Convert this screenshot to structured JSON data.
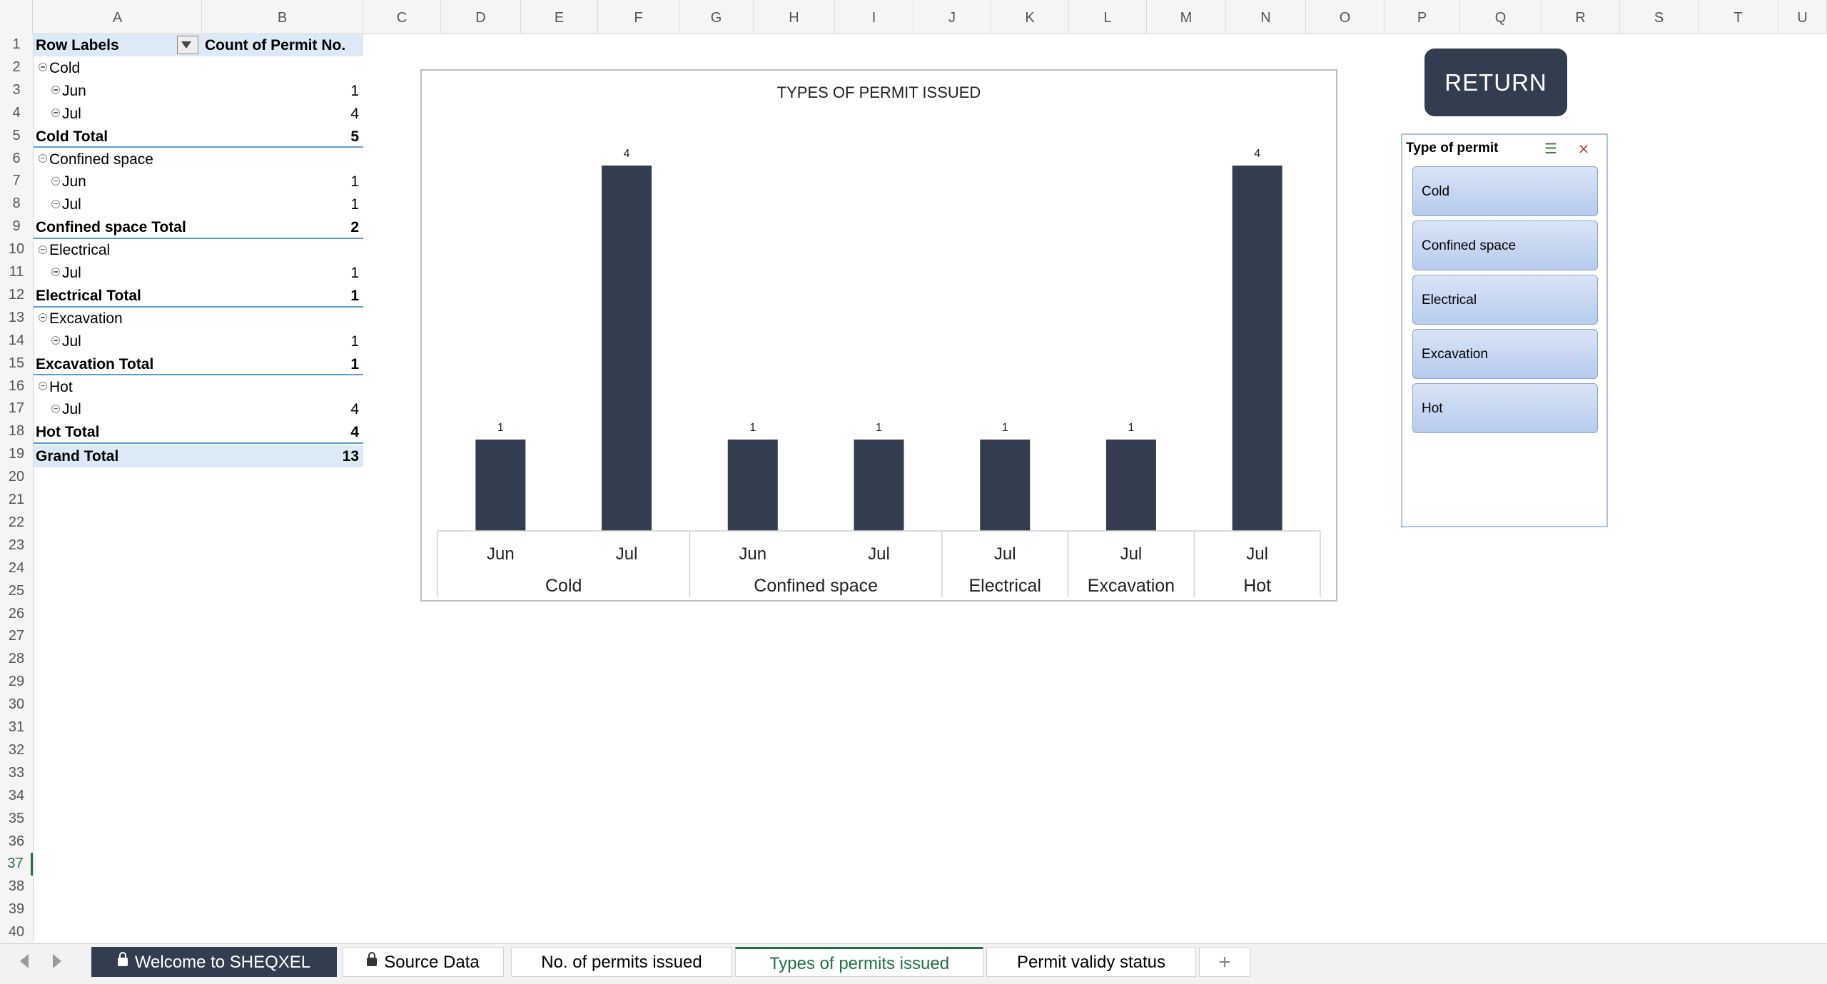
{
  "columns": [
    "A",
    "B",
    "C",
    "D",
    "E",
    "F",
    "G",
    "H",
    "I",
    "J",
    "K",
    "L",
    "M",
    "N",
    "O",
    "P",
    "Q",
    "R",
    "S",
    "T",
    "U"
  ],
  "rows": [
    "1",
    "2",
    "3",
    "4",
    "5",
    "6",
    "7",
    "8",
    "9",
    "10",
    "11",
    "12",
    "13",
    "14",
    "15",
    "16",
    "17",
    "18",
    "19",
    "20",
    "21",
    "22",
    "23",
    "24",
    "25",
    "26",
    "27",
    "28",
    "29",
    "30",
    "31",
    "32",
    "33",
    "34",
    "35",
    "36",
    "37",
    "38",
    "39",
    "40"
  ],
  "pivot": {
    "header_labels": "Row Labels",
    "header_count": "Count of Permit No.",
    "lines": [
      {
        "row": 2,
        "label": "Cold",
        "indent": 1,
        "value": "",
        "total": false
      },
      {
        "row": 3,
        "label": "Jun",
        "indent": 2,
        "value": "1",
        "total": false
      },
      {
        "row": 4,
        "label": "Jul",
        "indent": 2,
        "value": "4",
        "total": false
      },
      {
        "row": 5,
        "label": "Cold Total",
        "indent": 0,
        "value": "5",
        "total": true
      },
      {
        "row": 6,
        "label": "Confined space",
        "indent": 1,
        "value": "",
        "total": false
      },
      {
        "row": 7,
        "label": "Jun",
        "indent": 2,
        "value": "1",
        "total": false
      },
      {
        "row": 8,
        "label": "Jul",
        "indent": 2,
        "value": "1",
        "total": false
      },
      {
        "row": 9,
        "label": "Confined space Total",
        "indent": 0,
        "value": "2",
        "total": true
      },
      {
        "row": 10,
        "label": "Electrical",
        "indent": 1,
        "value": "",
        "total": false
      },
      {
        "row": 11,
        "label": "Jul",
        "indent": 2,
        "value": "1",
        "total": false
      },
      {
        "row": 12,
        "label": "Electrical Total",
        "indent": 0,
        "value": "1",
        "total": true
      },
      {
        "row": 13,
        "label": "Excavation",
        "indent": 1,
        "value": "",
        "total": false
      },
      {
        "row": 14,
        "label": "Jul",
        "indent": 2,
        "value": "1",
        "total": false
      },
      {
        "row": 15,
        "label": "Excavation Total",
        "indent": 0,
        "value": "1",
        "total": true
      },
      {
        "row": 16,
        "label": "Hot",
        "indent": 1,
        "value": "",
        "total": false
      },
      {
        "row": 17,
        "label": "Jul",
        "indent": 2,
        "value": "4",
        "total": false
      },
      {
        "row": 18,
        "label": "Hot Total",
        "indent": 0,
        "value": "4",
        "total": true
      }
    ],
    "grand_total_label": "Grand Total",
    "grand_total_value": "13"
  },
  "chart_data": {
    "type": "bar",
    "title": "TYPES OF PERMIT ISSUED",
    "categories": [
      "Jun",
      "Jul",
      "Jun",
      "Jul",
      "Jul",
      "Jul",
      "Jul"
    ],
    "groups": [
      {
        "name": "Cold",
        "span": 2
      },
      {
        "name": "Confined space",
        "span": 2
      },
      {
        "name": "Electrical",
        "span": 1
      },
      {
        "name": "Excavation",
        "span": 1
      },
      {
        "name": "Hot",
        "span": 1
      }
    ],
    "values": [
      1,
      4,
      1,
      1,
      1,
      1,
      4
    ],
    "ylim": [
      0,
      4
    ],
    "grid": false,
    "legend": "none",
    "bar_color": "#323e4f"
  },
  "return_button": "RETURN",
  "slicer": {
    "title": "Type of permit",
    "items": [
      "Cold",
      "Confined space",
      "Electrical",
      "Excavation",
      "Hot"
    ]
  },
  "tabs": {
    "welcome": "Welcome to SHEQXEL",
    "source": "Source Data",
    "permits": "No. of permits issued",
    "types": "Types of permits issued",
    "validity": "Permit validy status",
    "add": "+"
  },
  "colors": {
    "accent": "#1e7145",
    "dark": "#323e4f",
    "header_fill": "#dce9f7"
  }
}
